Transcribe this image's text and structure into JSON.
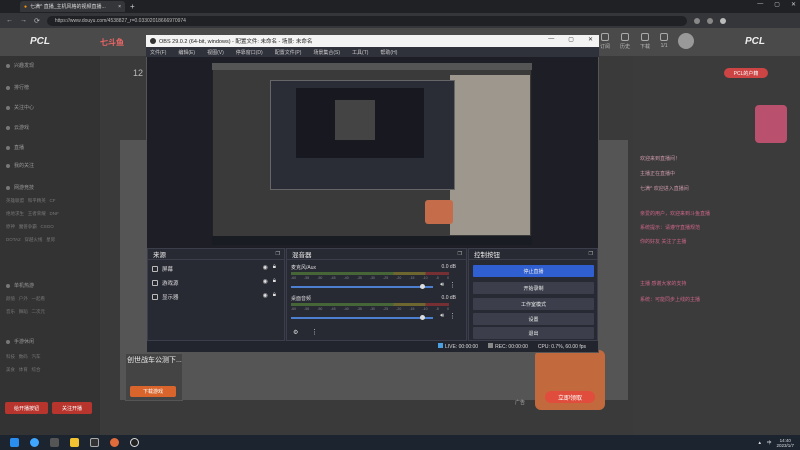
{
  "browser": {
    "tab_title": "七满^ 直播_主机风格的视频直播...",
    "tab_close": "×",
    "new_tab": "+",
    "window_controls": [
      "—",
      "▢",
      "✕"
    ],
    "url": "https://www.douyu.com/4538827_r=0.03302018666970974",
    "nav": [
      "←",
      "→",
      "⟳"
    ]
  },
  "site": {
    "logo": "PCL",
    "logo_center": "七斗鱼",
    "logo_right": "PCL",
    "header_items": [
      "订阅",
      "历史",
      "下载",
      "1/1"
    ],
    "room_number": "12",
    "pcl_button": "PCL的户籍",
    "sidebar": {
      "items": [
        "兴趣发现",
        "排行榜",
        "关注中心",
        "云游戏",
        "直播",
        "我的关注",
        "网游竞技",
        "单机热游",
        "手游休闲",
        "娱乐天地",
        "颜值",
        "科技文化"
      ],
      "grid_rows": [
        [
          "英雄联盟",
          "和平精英",
          "CF"
        ],
        [
          "绝地求生",
          "王者荣耀",
          "DNF"
        ],
        [
          "原神",
          "魔兽争霸",
          "CSGO"
        ],
        [
          "DOTA2",
          "穿越火线",
          "星际"
        ],
        [
          "颜值",
          "户外",
          "一起看"
        ],
        [
          "音乐",
          "舞蹈",
          "二次元"
        ],
        [
          "科技",
          "数码",
          "汽车"
        ],
        [
          "美食",
          "体育",
          "综合"
        ]
      ],
      "action_left": "给开播按钮",
      "action_right": "关注开播"
    },
    "chat_lines": [
      "欢迎来到直播间！",
      "主播正在直播中",
      "七满^ 欢迎进入直播间",
      "亲爱的用户，欢迎来到斗鱼直播",
      "系统提示：请遵守直播规范",
      "你的好友 关注了主播",
      "主播 感谢大家的支持",
      "系统：可能同步上线的主播"
    ],
    "ad_card_title": "创世战车公测下...",
    "ad_card_button": "下载游戏",
    "gift_button": "立即领取",
    "ad_label": "广告"
  },
  "obs": {
    "title": "OBS 29.0.2 (64-bit, windows) - 配置文件: 未命名 - 场景: 未命名",
    "window_controls": [
      "—",
      "▢",
      "✕"
    ],
    "menu": [
      "文件(F)",
      "编辑(E)",
      "视图(V)",
      "停靠窗口(D)",
      "配置文件(P)",
      "场景集合(S)",
      "工具(T)",
      "帮助(H)"
    ],
    "sources": {
      "title": "来源",
      "items": [
        {
          "name": "屏幕",
          "icon": "monitor-icon"
        },
        {
          "name": "游戏源",
          "icon": "gamepad-icon"
        },
        {
          "name": "显示器",
          "icon": "display-icon"
        }
      ]
    },
    "mixer": {
      "title": "混音器",
      "channels": [
        {
          "name": "麦克风/Aux",
          "db": "0.0 dB",
          "ticks": [
            "-60",
            "-55",
            "-50",
            "-45",
            "-40",
            "-35",
            "-30",
            "-25",
            "-20",
            "-15",
            "-10",
            "-5",
            "0"
          ],
          "level": 0.92
        },
        {
          "name": "桌面音频",
          "db": "0.0 dB",
          "ticks": [
            "-60",
            "-55",
            "-50",
            "-45",
            "-40",
            "-35",
            "-30",
            "-25",
            "-20",
            "-15",
            "-10",
            "-5",
            "0"
          ],
          "level": 0.92
        }
      ]
    },
    "controls": {
      "title": "控制按钮",
      "buttons": [
        "停止直播",
        "开始录制",
        "工作室模式",
        "设置",
        "退出"
      ]
    },
    "status": {
      "live": "LIVE: 00:00:00",
      "rec": "REC: 00:00:00",
      "cpu": "CPU: 0.7%, 60.00 fps"
    }
  },
  "taskbar": {
    "time": "14:40",
    "date": "2023/1/7",
    "tray": "中"
  },
  "colors": {
    "accent_blue": "#2f5fd0",
    "brand_red": "#c44",
    "obs_bg": "#2a2c36"
  }
}
